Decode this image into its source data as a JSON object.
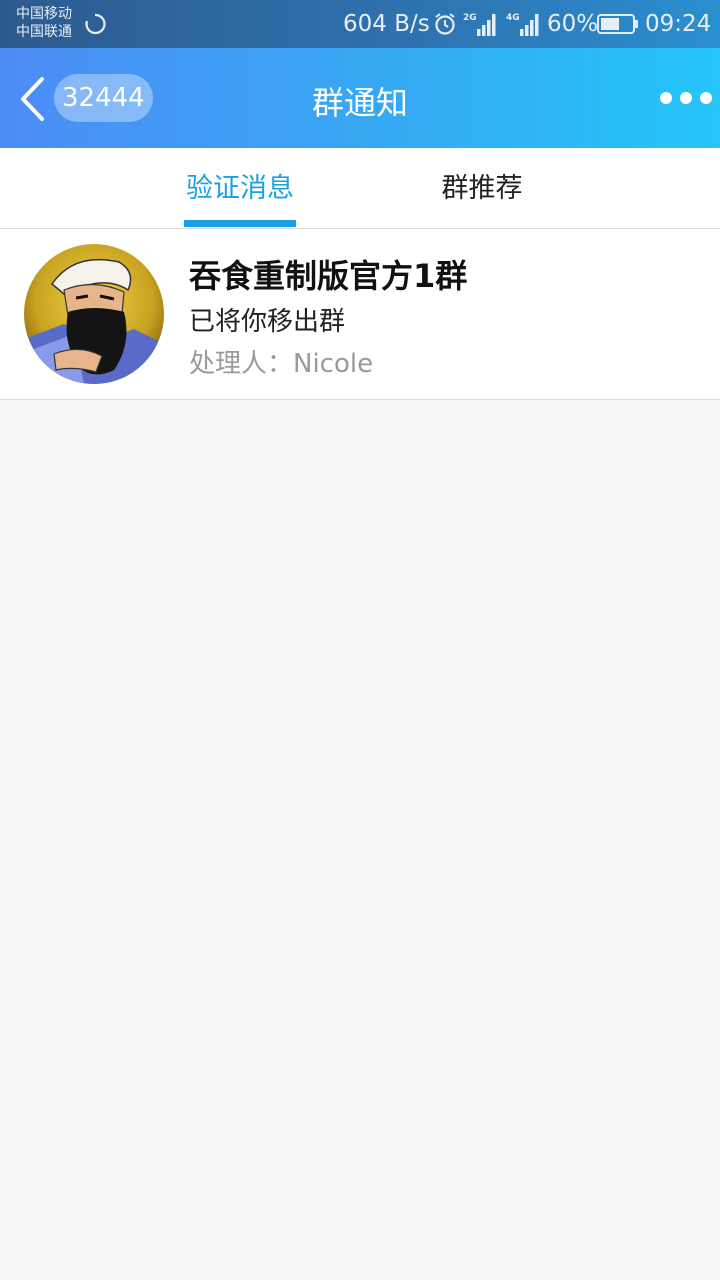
{
  "status_bar": {
    "carrier1": "中国移动",
    "carrier2": "中国联通",
    "net_speed": "604 B/s",
    "sig2_label": "2G",
    "sig4_label": "4G",
    "battery": "60%",
    "battery_level": 0.6,
    "time": "09:24"
  },
  "header": {
    "unread_count": "32444",
    "title": "群通知",
    "colors": {
      "start": "#4d8cf5",
      "end": "#25c4fb"
    }
  },
  "tabs": [
    {
      "label": "验证消息",
      "active": true
    },
    {
      "label": "群推荐",
      "active": false
    }
  ],
  "accent_color": "#1aa0e6",
  "notices": [
    {
      "group_name": "吞食重制版官方1群",
      "message": "已将你移出群",
      "handler": "处理人：Nicole",
      "avatar": "guan-yu-portrait"
    }
  ]
}
